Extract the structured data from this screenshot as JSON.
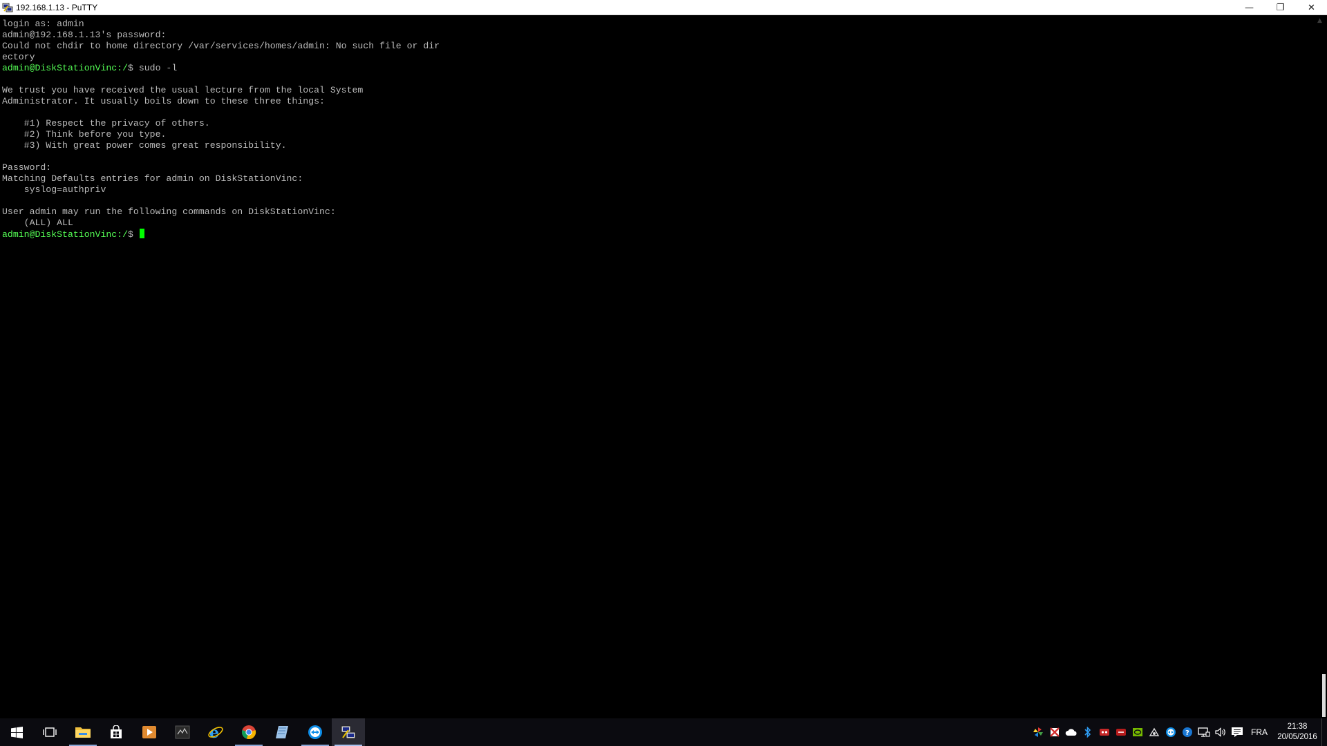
{
  "window": {
    "title": "192.168.1.13 - PuTTY",
    "controls": {
      "minimize": "—",
      "restore": "❐",
      "close": "✕"
    }
  },
  "terminal": {
    "colors": {
      "text": "#bbbbbb",
      "prompt": "#55ff55",
      "cursor": "#00ff00",
      "background": "#000000"
    },
    "lines": [
      {
        "text": "login as: admin"
      },
      {
        "text": "admin@192.168.1.13's password:"
      },
      {
        "text": "Could not chdir to home directory /var/services/homes/admin: No such file or dir"
      },
      {
        "text": "ectory"
      },
      {
        "prompt": "admin@DiskStationVinc:/",
        "text": "$ sudo -l"
      },
      {
        "text": ""
      },
      {
        "text": "We trust you have received the usual lecture from the local System"
      },
      {
        "text": "Administrator. It usually boils down to these three things:"
      },
      {
        "text": ""
      },
      {
        "text": "    #1) Respect the privacy of others."
      },
      {
        "text": "    #2) Think before you type."
      },
      {
        "text": "    #3) With great power comes great responsibility."
      },
      {
        "text": ""
      },
      {
        "text": "Password:"
      },
      {
        "text": "Matching Defaults entries for admin on DiskStationVinc:"
      },
      {
        "text": "    syslog=authpriv"
      },
      {
        "text": ""
      },
      {
        "text": "User admin may run the following commands on DiskStationVinc:"
      },
      {
        "text": "    (ALL) ALL"
      },
      {
        "prompt": "admin@DiskStationVinc:/",
        "text": "$ ",
        "cursor": true
      }
    ]
  },
  "taskbar": {
    "apps": [
      {
        "name": "start-button",
        "icon": "windows-logo-icon"
      },
      {
        "name": "task-view-button",
        "icon": "task-view-icon"
      },
      {
        "name": "file-explorer-button",
        "icon": "folder-icon",
        "running": true
      },
      {
        "name": "store-button",
        "icon": "store-bag-icon"
      },
      {
        "name": "media-player-button",
        "icon": "media-player-icon"
      },
      {
        "name": "sysinternals-button",
        "icon": "terminal-app-icon"
      },
      {
        "name": "internet-explorer-button",
        "icon": "internet-explorer-icon"
      },
      {
        "name": "chrome-button",
        "icon": "chrome-icon",
        "running": true
      },
      {
        "name": "notes-button",
        "icon": "notepad-icon"
      },
      {
        "name": "teamviewer-button",
        "icon": "teamviewer-icon",
        "running": true
      },
      {
        "name": "putty-button",
        "icon": "putty-icon",
        "running": true,
        "active": true
      }
    ],
    "tray": {
      "icons": [
        "pinwheel-icon",
        "flag-icon",
        "onedrive-cloud-icon",
        "bluetooth-icon",
        "red-app-icon",
        "red-app-2-icon",
        "nvidia-icon",
        "network-tool-icon",
        "teamviewer-tray-icon",
        "help-icon",
        "network-icon",
        "volume-icon",
        "action-center-icon"
      ],
      "language": "FRA",
      "time": "21:38",
      "date": "20/05/2016"
    }
  }
}
